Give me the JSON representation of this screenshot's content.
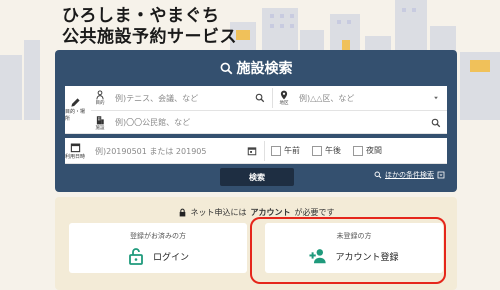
{
  "site": {
    "title_line1": "ひろしま・やまぐち",
    "title_line2": "公共施設予約サービス"
  },
  "search": {
    "heading": "施設検索",
    "purpose": {
      "row_label": "目的・場所",
      "activity_icon_label": "目的",
      "activity_placeholder": "例)テニス、会議、など",
      "area_icon_label": "地区",
      "area_placeholder": "例)△△区、など"
    },
    "facility": {
      "icon_label": "施設",
      "placeholder": "例)〇〇公民館、など"
    },
    "datetime": {
      "row_label": "利用日時",
      "date_placeholder": "例)20190501 または 201905",
      "slots": [
        "午前",
        "午後",
        "夜間"
      ]
    },
    "submit_label": "検索",
    "more_conditions_label": "ほかの条件検索"
  },
  "account": {
    "note_prefix": "ネット申込には",
    "note_bold": "アカウント",
    "note_suffix": "が必要です",
    "registered": {
      "caption": "登録がお済みの方",
      "action": "ログイン"
    },
    "unregistered": {
      "caption": "未登録の方",
      "action": "アカウント登録"
    }
  },
  "colors": {
    "panel": "#34506f",
    "button": "#1e2e42",
    "accent_green": "#1f9a7c",
    "highlight_red": "#e5261b"
  }
}
